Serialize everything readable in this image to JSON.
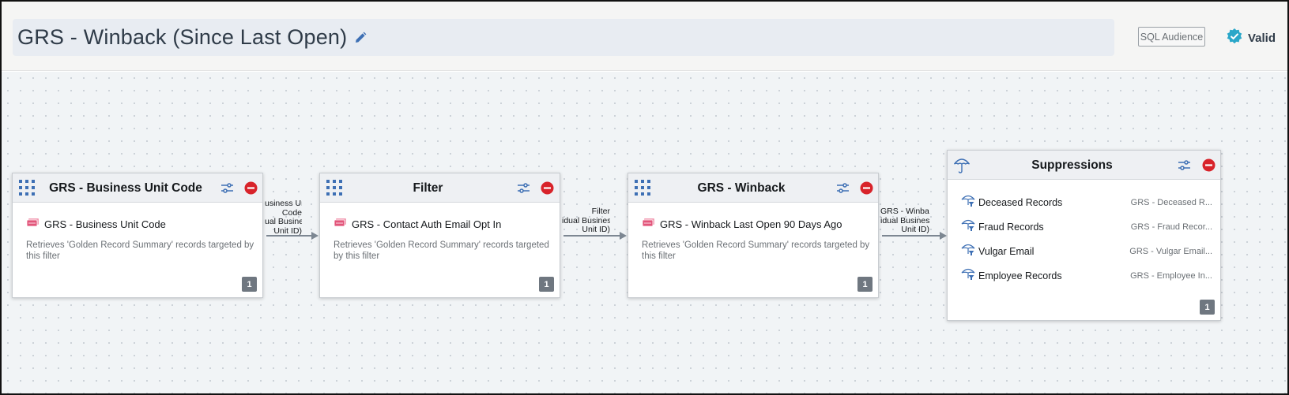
{
  "header": {
    "title": "GRS - Winback (Since Last Open)",
    "sql_button": "SQL Audience",
    "status": "Valid",
    "status_color": "#2aa7c9"
  },
  "nodes": [
    {
      "title": "GRS - Business Unit Code",
      "filter": "GRS - Business Unit Code",
      "description_line1": "Retrieves 'Golden Record Summary' records targeted by",
      "description_line2": "this filter",
      "count": "1"
    },
    {
      "title": "Filter",
      "filter": "GRS - Contact Auth Email Opt In",
      "description_line1": "Retrieves 'Golden Record Summary' records targeted",
      "description_line2": "by this filter",
      "count": "1"
    },
    {
      "title": "GRS - Winback",
      "filter": "GRS - Winback Last Open 90 Days Ago",
      "description_line1": "Retrieves 'Golden Record Summary' records targeted by",
      "description_line2": "this filter",
      "count": "1"
    }
  ],
  "connectors": [
    {
      "line1": "usiness Unit",
      "line2": "Code",
      "line3": "ual Business",
      "line4": "Unit ID)"
    },
    {
      "line1": "Filter",
      "line2": "idual Business",
      "line3": "Unit ID)"
    },
    {
      "line1": "GRS - Winback",
      "line2": "idual Business",
      "line3": "Unit ID)"
    }
  ],
  "suppressions": {
    "title": "Suppressions",
    "count": "1",
    "items": [
      {
        "label": "Deceased Records",
        "source": "GRS - Deceased R..."
      },
      {
        "label": "Fraud Records",
        "source": "GRS - Fraud Recor..."
      },
      {
        "label": "Vulgar Email",
        "source": "GRS - Vulgar Email..."
      },
      {
        "label": "Employee Records",
        "source": "GRS - Employee In..."
      }
    ]
  },
  "colors": {
    "icon_blue": "#3d6fb4",
    "remove_red": "#d8232a",
    "badge_gray": "#6f7780",
    "arrow_gray": "#7d8792"
  }
}
